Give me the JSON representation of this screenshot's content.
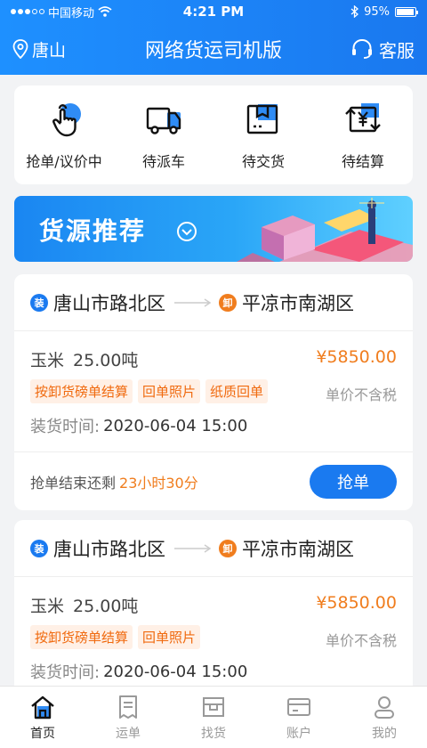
{
  "status_bar": {
    "carrier": "中国移动",
    "time": "4:21 PM",
    "battery": "95%",
    "battery_level": 0.95
  },
  "navbar": {
    "location": "唐山",
    "title": "网络货运司机版",
    "service": "客服"
  },
  "quick_menu": [
    {
      "label": "抢单/议价中",
      "icon": "tap-hand-icon"
    },
    {
      "label": "待派车",
      "icon": "truck-icon"
    },
    {
      "label": "待交货",
      "icon": "package-icon"
    },
    {
      "label": "待结算",
      "icon": "settlement-icon"
    }
  ],
  "banner": {
    "title": "货源推荐"
  },
  "orders": [
    {
      "load_badge": "装",
      "from": "唐山市路北区",
      "unload_badge": "卸",
      "to": "平凉市南湖区",
      "goods": "玉米",
      "weight": "25.00吨",
      "price": "¥5850.00",
      "tags": [
        "按卸货磅单结算",
        "回单照片",
        "纸质回单"
      ],
      "tax_note": "单价不含税",
      "load_time_label": "装货时间:",
      "load_time": "2020-06-04 15:00",
      "countdown_label": "抢单结束还剩",
      "countdown": "23小时30分",
      "button": "抢单"
    },
    {
      "load_badge": "装",
      "from": "唐山市路北区",
      "unload_badge": "卸",
      "to": "平凉市南湖区",
      "goods": "玉米",
      "weight": "25.00吨",
      "price": "¥5850.00",
      "tags": [
        "按卸货磅单结算",
        "回单照片"
      ],
      "tax_note": "单价不含税",
      "load_time_label": "装货时间:",
      "load_time": "2020-06-04 15:00"
    }
  ],
  "tabbar": [
    {
      "label": "首页",
      "icon": "home-icon",
      "active": true
    },
    {
      "label": "运单",
      "icon": "waybill-icon",
      "active": false
    },
    {
      "label": "找货",
      "icon": "find-goods-icon",
      "active": false
    },
    {
      "label": "账户",
      "icon": "account-card-icon",
      "active": false
    },
    {
      "label": "我的",
      "icon": "profile-icon",
      "active": false
    }
  ],
  "colors": {
    "primary": "#1a7af0",
    "accent": "#f07d1e",
    "tag_bg": "#fff0e6"
  }
}
